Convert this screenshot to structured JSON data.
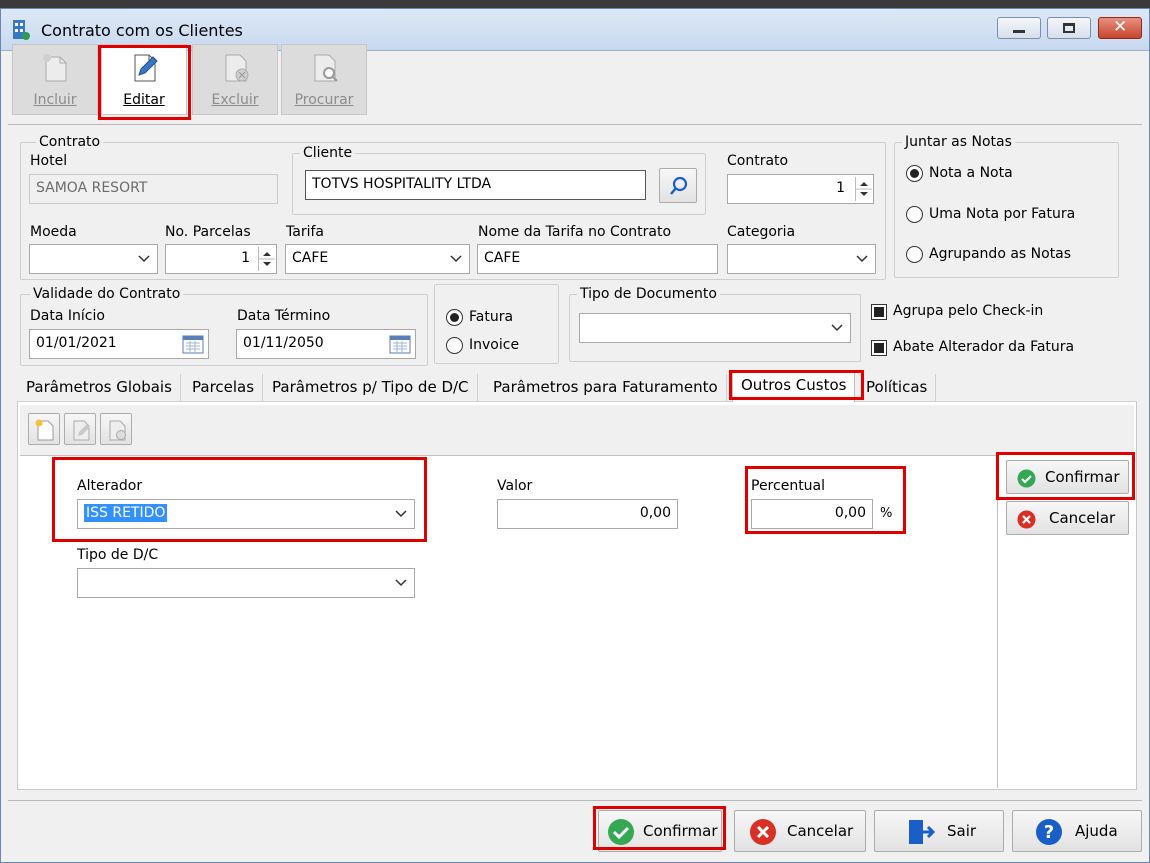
{
  "window": {
    "title": "Contrato com os Clientes"
  },
  "toolbar": {
    "incluir": "Incluir",
    "editar": "Editar",
    "excluir": "Excluir",
    "procurar": "Procurar"
  },
  "contrato_group": {
    "title": "Contrato"
  },
  "hotel": {
    "label": "Hotel",
    "value": "SAMOA RESORT"
  },
  "cliente": {
    "title": "Cliente",
    "value": "TOTVS HOSPITALITY LTDA"
  },
  "contrato": {
    "label": "Contrato",
    "value": "1"
  },
  "moeda": {
    "label": "Moeda",
    "value": ""
  },
  "parcelas": {
    "label": "No. Parcelas",
    "value": "1"
  },
  "tarifa": {
    "label": "Tarifa",
    "value": "CAFE"
  },
  "nome_tarifa": {
    "label": "Nome da Tarifa no Contrato",
    "value": "CAFE"
  },
  "categoria": {
    "label": "Categoria",
    "value": ""
  },
  "juntar": {
    "title": "Juntar as Notas",
    "options": [
      "Nota a Nota",
      "Uma Nota por Fatura",
      "Agrupando as Notas"
    ],
    "selected": "Nota a Nota"
  },
  "validade": {
    "title": "Validade do Contrato",
    "inicio_label": "Data Início",
    "inicio": "01/01/2021",
    "termino_label": "Data Término",
    "termino": "01/11/2050"
  },
  "tipo_faturamento": {
    "options": [
      "Fatura",
      "Invoice"
    ],
    "selected": "Fatura"
  },
  "tipo_documento": {
    "title": "Tipo de Documento",
    "value": ""
  },
  "checks": {
    "agrupa": "Agrupa pelo Check-in",
    "abate": "Abate Alterador da Fatura"
  },
  "tabs": [
    "Parâmetros Globais",
    "Parcelas",
    "Parâmetros p/ Tipo de D/C",
    "Parâmetros para Faturamento",
    "Outros Custos",
    "Políticas"
  ],
  "active_tab": "Outros Custos",
  "outros": {
    "alterador_label": "Alterador",
    "alterador_value": "ISS RETIDO",
    "valor_label": "Valor",
    "valor_value": "0,00",
    "percentual_label": "Percentual",
    "percentual_value": "0,00",
    "percent_sign": "%",
    "tipo_dc_label": "Tipo de D/C",
    "tipo_dc_value": "",
    "confirmar": "Confirmar",
    "cancelar": "Cancelar"
  },
  "footer": {
    "confirmar": "Confirmar",
    "cancelar": "Cancelar",
    "sair": "Sair",
    "ajuda": "Ajuda"
  },
  "colors": {
    "highlight": "#e00000",
    "selection": "#3390ff",
    "confirm_green": "#34a853",
    "cancel_red": "#d93025",
    "help_blue": "#1a5fc8"
  }
}
